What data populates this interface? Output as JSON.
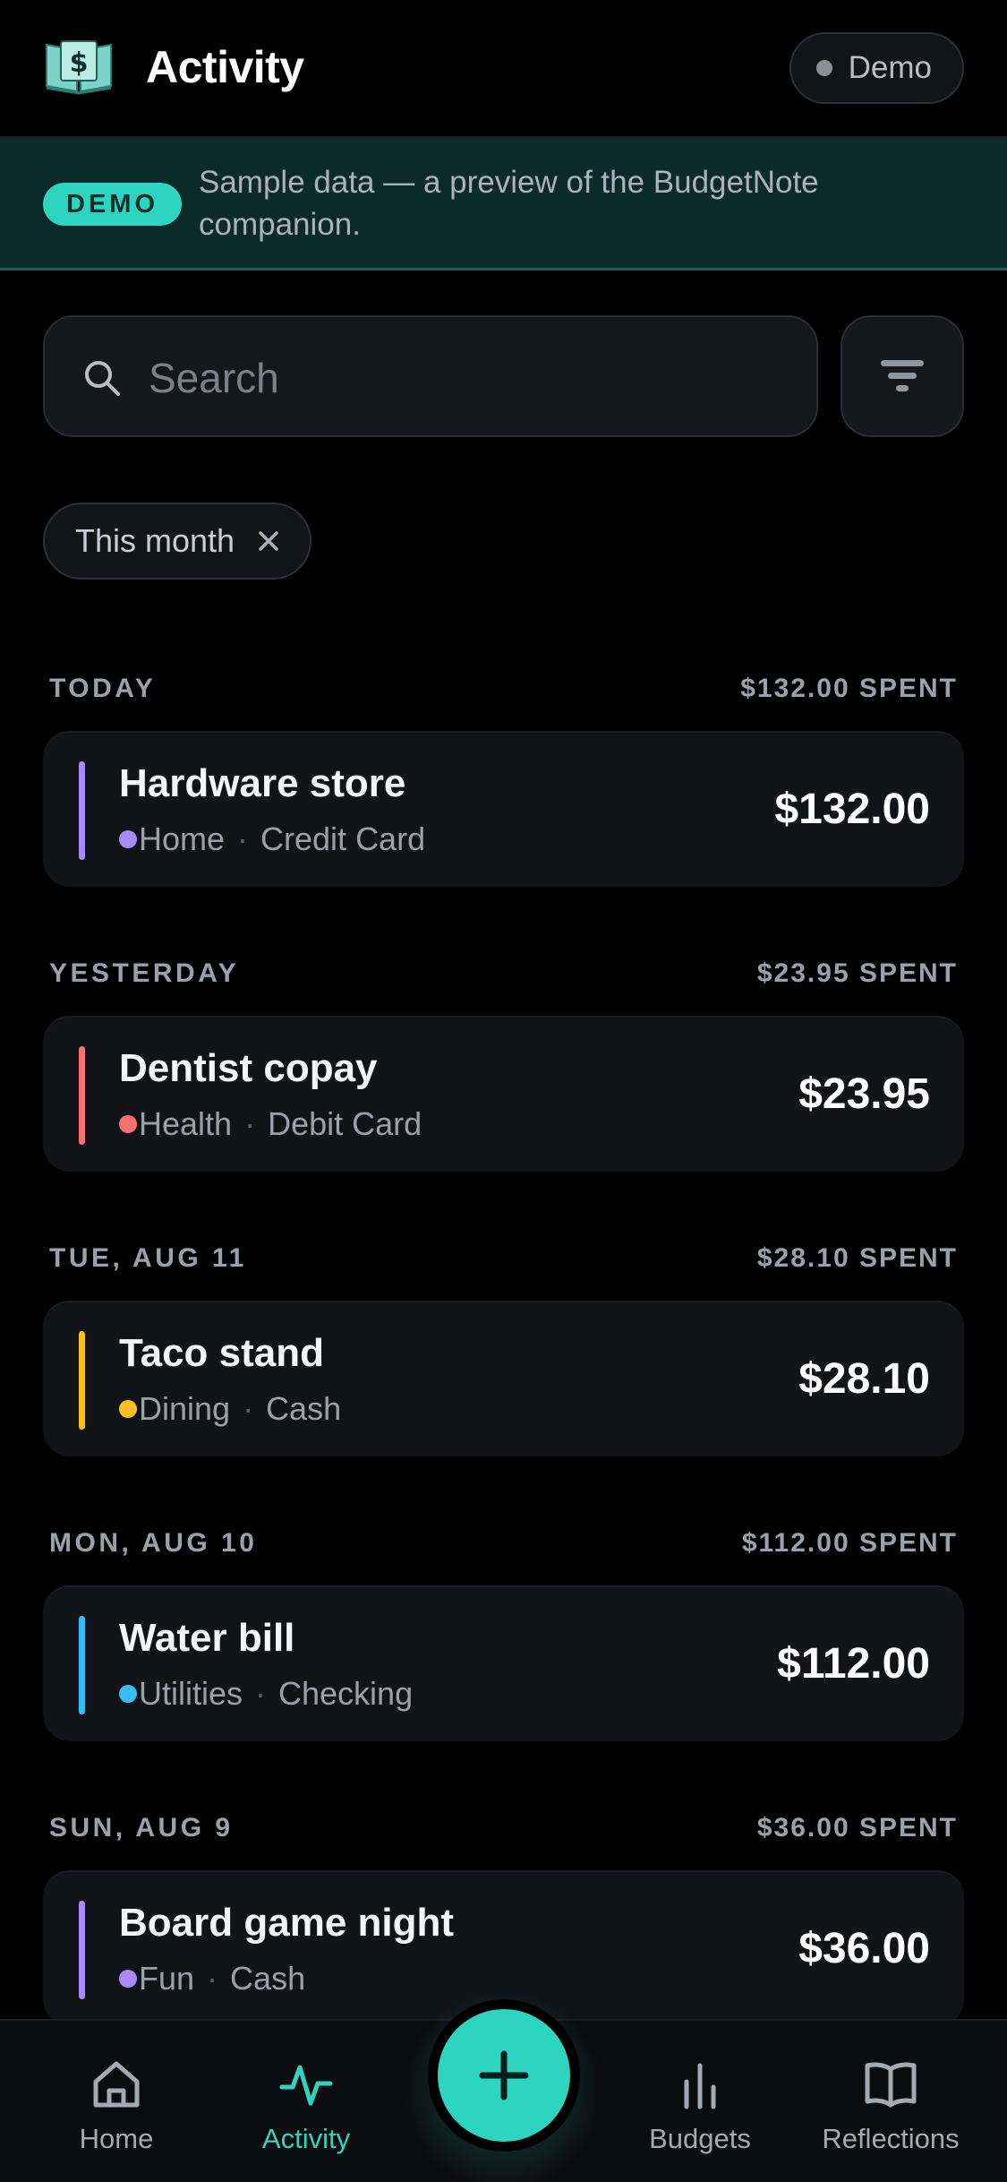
{
  "header": {
    "title": "Activity",
    "mode_label": "Demo"
  },
  "banner": {
    "badge": "DEMO",
    "text": "Sample data — a preview of the BudgetNote companion."
  },
  "search": {
    "placeholder": "Search",
    "value": ""
  },
  "filters": {
    "active_chip": "This month"
  },
  "sections": [
    {
      "day": "TODAY",
      "total": "$132.00 SPENT",
      "transaction": {
        "title": "Hardware store",
        "category": "Home",
        "account": "Credit Card",
        "amount": "$132.00",
        "color": "#a78bfa"
      }
    },
    {
      "day": "YESTERDAY",
      "total": "$23.95 SPENT",
      "transaction": {
        "title": "Dentist copay",
        "category": "Health",
        "account": "Debit Card",
        "amount": "$23.95",
        "color": "#f87171"
      }
    },
    {
      "day": "TUE, AUG 11",
      "total": "$28.10 SPENT",
      "transaction": {
        "title": "Taco stand",
        "category": "Dining",
        "account": "Cash",
        "amount": "$28.10",
        "color": "#fbbf24"
      }
    },
    {
      "day": "MON, AUG 10",
      "total": "$112.00 SPENT",
      "transaction": {
        "title": "Water bill",
        "category": "Utilities",
        "account": "Checking",
        "amount": "$112.00",
        "color": "#38bdf8"
      }
    },
    {
      "day": "SUN, AUG 9",
      "total": "$36.00 SPENT",
      "transaction": {
        "title": "Board game night",
        "category": "Fun",
        "account": "Cash",
        "amount": "$36.00",
        "color": "#a78bfa"
      }
    }
  ],
  "nav": {
    "home": "Home",
    "activity": "Activity",
    "budgets": "Budgets",
    "reflections": "Reflections",
    "active": "activity"
  },
  "colors": {
    "accent": "#2dd4bf",
    "background": "#000000",
    "card": "#111317"
  },
  "icons": {
    "logo": "money-book-icon",
    "search": "search-icon",
    "filter": "filter-icon",
    "chip_close": "close-icon",
    "home": "home-icon",
    "activity": "activity-pulse-icon",
    "add": "plus-icon",
    "budgets": "bar-chart-icon",
    "reflections": "open-book-icon"
  }
}
